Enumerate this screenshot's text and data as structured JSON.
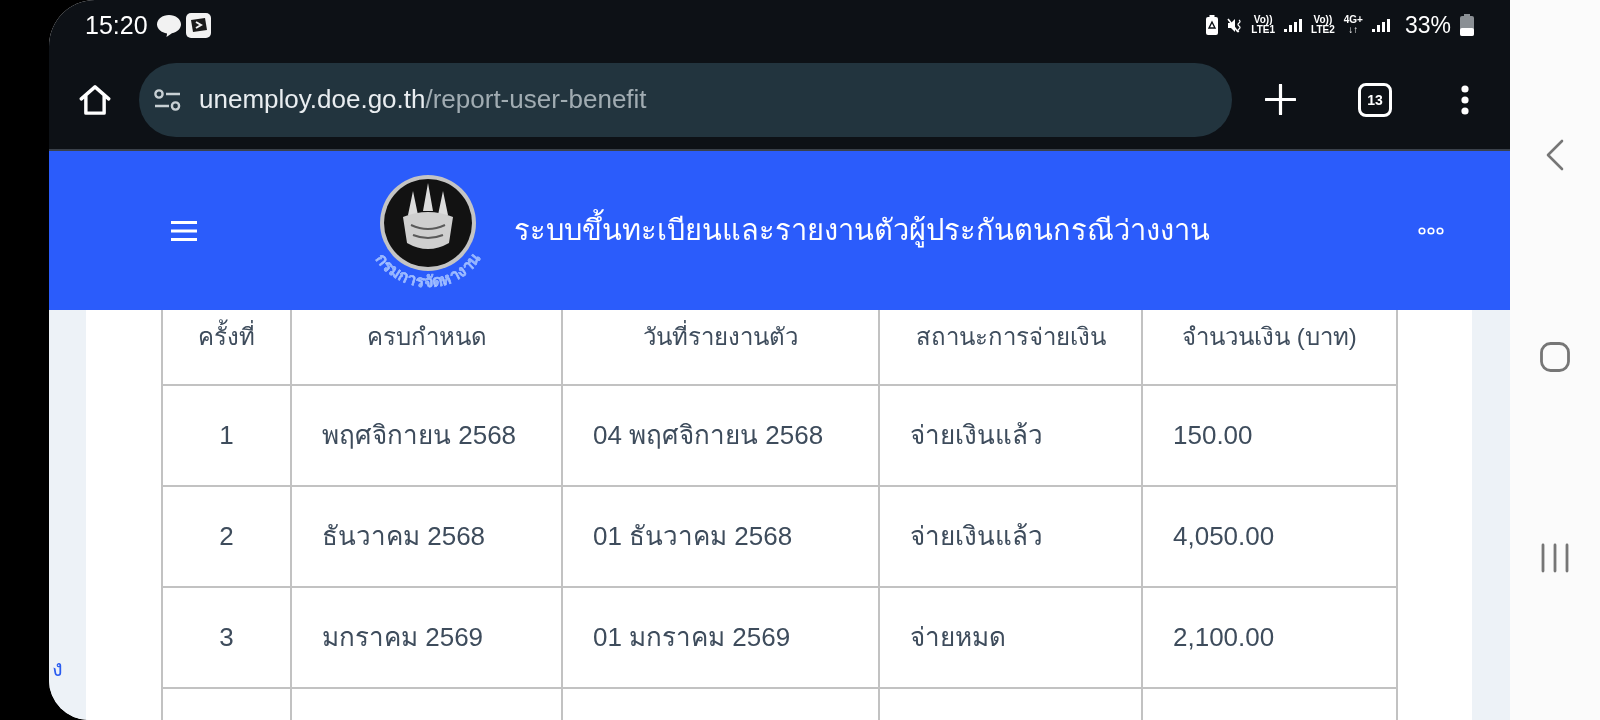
{
  "status_bar": {
    "time": "15:20",
    "indicators": [
      {
        "top": "Vo))",
        "bottom": "LTE1"
      },
      {
        "top": "Vo))",
        "bottom": "LTE2"
      },
      {
        "top": "4G+",
        "bottom": "↓↑"
      }
    ],
    "battery_text": "33%"
  },
  "browser": {
    "url": {
      "host": "unemploy.doe.go.th",
      "path": "/report-user-benefit"
    },
    "tab_count": "13"
  },
  "header": {
    "logo_caption": "กรมการจัดหางาน",
    "title": "ระบบขึ้นทะเบียนและรายงานตัวผู้ประกันตนกรณีว่างงาน"
  },
  "side_panel": {
    "fragment": "ง"
  },
  "table": {
    "columns": [
      "ครั้งที่",
      "ครบกำหนด",
      "วันที่รายงานตัว",
      "สถานะการจ่ายเงิน",
      "จำนวนเงิน (บาท)"
    ],
    "rows": [
      [
        "1",
        "พฤศจิกายน 2568",
        "04 พฤศจิกายน 2568",
        "จ่ายเงินแล้ว",
        "150.00"
      ],
      [
        "2",
        "ธันวาคม 2568",
        "01 ธันวาคม 2568",
        "จ่ายเงินแล้ว",
        "4,050.00"
      ],
      [
        "3",
        "มกราคม 2569",
        "01 มกราคม 2569",
        "จ่ายหมด",
        "2,100.00"
      ]
    ]
  }
}
